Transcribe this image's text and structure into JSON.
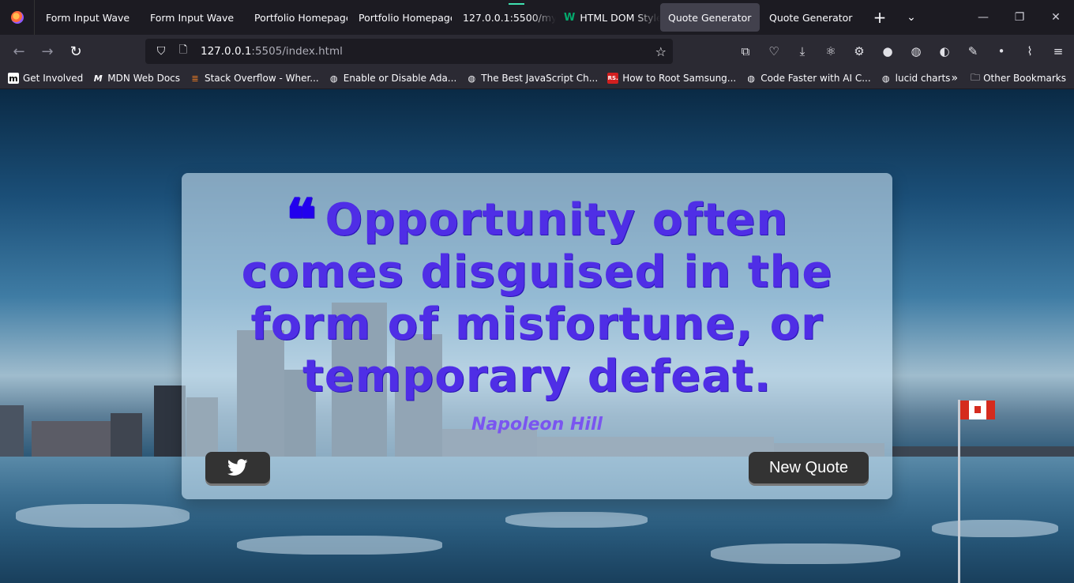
{
  "browser": {
    "tabs": [
      {
        "label": "Form Input Wave",
        "favicon": ""
      },
      {
        "label": "Form Input Wave",
        "favicon": ""
      },
      {
        "label": "Portfolio Homepage",
        "favicon": ""
      },
      {
        "label": "Portfolio Homepage",
        "favicon": ""
      },
      {
        "label": "127.0.0.1:5500/my-w",
        "favicon": ""
      },
      {
        "label": "HTML DOM Style",
        "favicon": "W"
      },
      {
        "label": "Quote Generator",
        "favicon": "",
        "active": true
      },
      {
        "label": "Quote Generator",
        "favicon": ""
      }
    ],
    "url": {
      "host": "127.0.0.1",
      "path": ":5505/index.html"
    },
    "bookmarks": [
      {
        "label": "Get Involved",
        "icon": "m"
      },
      {
        "label": "MDN Web Docs",
        "icon": "M"
      },
      {
        "label": "Stack Overflow - Wher...",
        "icon": "so-icon"
      },
      {
        "label": "Enable or Disable Ada...",
        "icon": "globe-icon"
      },
      {
        "label": "The Best JavaScript Ch...",
        "icon": "globe-icon"
      },
      {
        "label": "How to Root Samsung...",
        "icon": "RS."
      },
      {
        "label": "Code Faster with AI C...",
        "icon": "globe-icon"
      },
      {
        "label": "lucid charts",
        "icon": "globe-icon"
      }
    ],
    "other_bookmarks": "Other Bookmarks"
  },
  "quote": {
    "text": "Opportunity often comes disguised in the form of misfortune, or temporary defeat.",
    "author": "Napoleon Hill",
    "new_quote_label": "New Quote",
    "mark": "❝"
  },
  "colors": {
    "quote_text": "#4f2ee6",
    "quote_author": "#7a55f0",
    "button_bg": "#333333"
  }
}
